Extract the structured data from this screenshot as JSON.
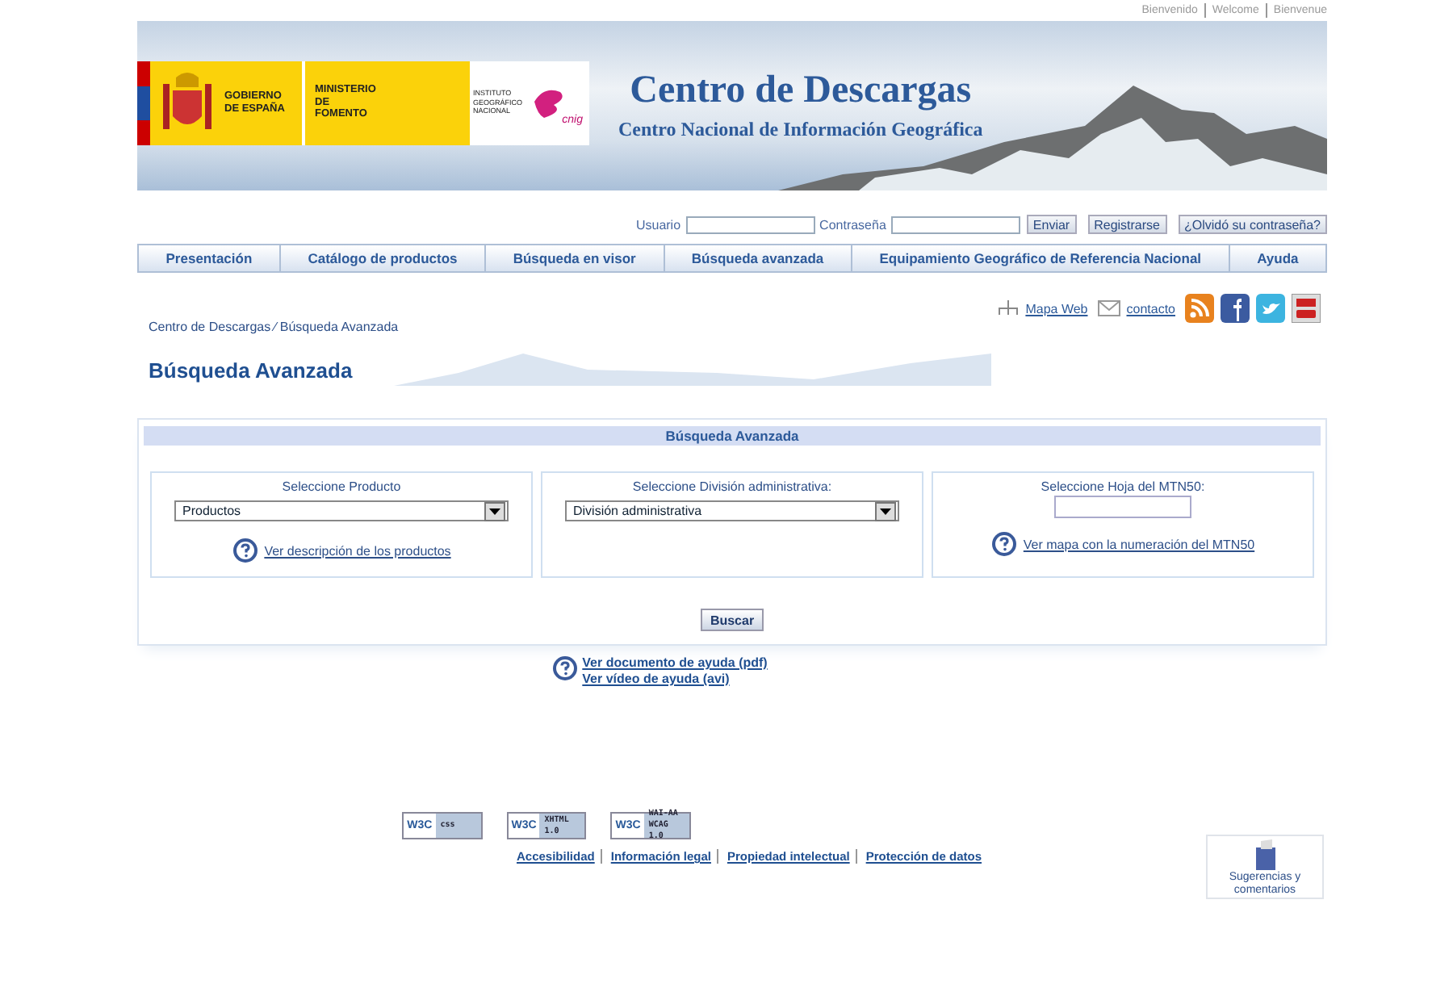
{
  "top_links": [
    "Bienvenido",
    "Welcome",
    "Bienvenue"
  ],
  "banner": {
    "gov": "GOBIERNO DE ESPAÑA",
    "ministry": "MINISTERIO DE FOMENTO",
    "institute": "INSTITUTO GEOGRÁFICO NACIONAL",
    "cnig": "cnig",
    "title": "Centro de Descargas",
    "subtitle": "Centro Nacional de Información Geográfica"
  },
  "login": {
    "user_label": "Usuario",
    "password_label": "Contraseña",
    "buttons": [
      "Enviar",
      "Registrarse",
      "¿Olvidó su contraseña?"
    ]
  },
  "nav": [
    {
      "label": "Presentación",
      "selected": false
    },
    {
      "label": "Catálogo de productos",
      "selected": false
    },
    {
      "label": "Búsqueda en visor",
      "selected": false
    },
    {
      "label": "Búsqueda avanzada",
      "selected": false
    },
    {
      "label": "Equipamiento Geográfico de Referencia Nacional",
      "selected": false
    },
    {
      "label": "Ayuda",
      "selected": false
    }
  ],
  "utility_links": [
    "Mapa Web",
    "contacto"
  ],
  "breadcrumb": "Centro de Descargas ⁄ Búsqueda Avanzada",
  "heading": "Búsqueda Avanzada",
  "search_panel": {
    "title": "Búsqueda Avanzada",
    "boxes": [
      {
        "kind": "select",
        "label": "Seleccione Producto",
        "value": "Productos",
        "link": "Ver descripción de los productos"
      },
      {
        "kind": "select",
        "label": "Seleccione División administrativa:",
        "value": "División administrativa"
      },
      {
        "kind": "input",
        "label": "Seleccione Hoja del MTN50:",
        "link": "Ver mapa con la numeración del MTN50"
      }
    ],
    "button": "Buscar"
  },
  "help_links": [
    "Ver documento de ayuda (pdf)",
    "Ver vídeo de ayuda (avi)"
  ],
  "badges": [
    {
      "left": "W3C",
      "right": "css"
    },
    {
      "left": "W3C",
      "right": "XHTML 1.0"
    },
    {
      "left": "W3C",
      "right": "WAI-AA WCAG 1.0"
    }
  ],
  "footer_links": [
    "Accesibilidad",
    "Información legal",
    "Propiedad intelectual",
    "Protección de datos"
  ],
  "suggestions": "Sugerencias y comentarios"
}
